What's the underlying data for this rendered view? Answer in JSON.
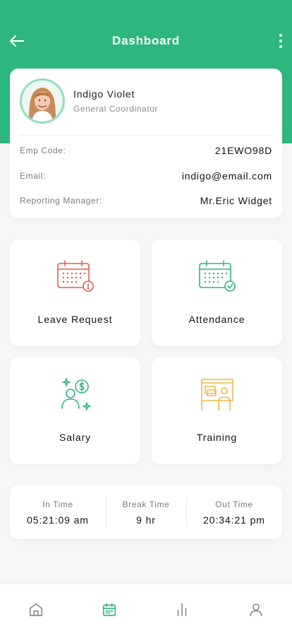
{
  "header": {
    "title": "Dashboard",
    "back_icon": "arrow-left-icon",
    "more_icon": "more-vertical-icon",
    "bg_color": "#2eb67f"
  },
  "profile": {
    "name": "Indigo Violet",
    "role": "General Coordinator",
    "fields": [
      {
        "label": "Emp Code:",
        "value": "21EWO98D"
      },
      {
        "label": "Email:",
        "value": "indigo@email.com"
      },
      {
        "label": "Reporting Manager:",
        "value": "Mr.Eric Widget"
      }
    ]
  },
  "tiles": [
    {
      "label": "Leave Request",
      "icon": "calendar-alert-icon",
      "color": "#e25b50"
    },
    {
      "label": "Attendance",
      "icon": "calendar-check-icon",
      "color": "#2eb67f"
    },
    {
      "label": "Salary",
      "icon": "salary-user-dollar-icon",
      "color": "#2eb67f"
    },
    {
      "label": "Training",
      "icon": "training-board-icon",
      "color": "#f2b94b"
    }
  ],
  "time": [
    {
      "label": "In Time",
      "value": "05:21:09 am"
    },
    {
      "label": "Break Time",
      "value": "9 hr"
    },
    {
      "label": "Out Time",
      "value": "20:34:21 pm"
    }
  ],
  "bottom_nav": [
    {
      "icon": "home-icon",
      "active": false
    },
    {
      "icon": "calendar-icon",
      "active": true
    },
    {
      "icon": "bar-chart-icon",
      "active": false
    },
    {
      "icon": "user-icon",
      "active": false
    }
  ],
  "colors": {
    "active": "#2eb67f",
    "inactive": "#8c8c8c"
  }
}
